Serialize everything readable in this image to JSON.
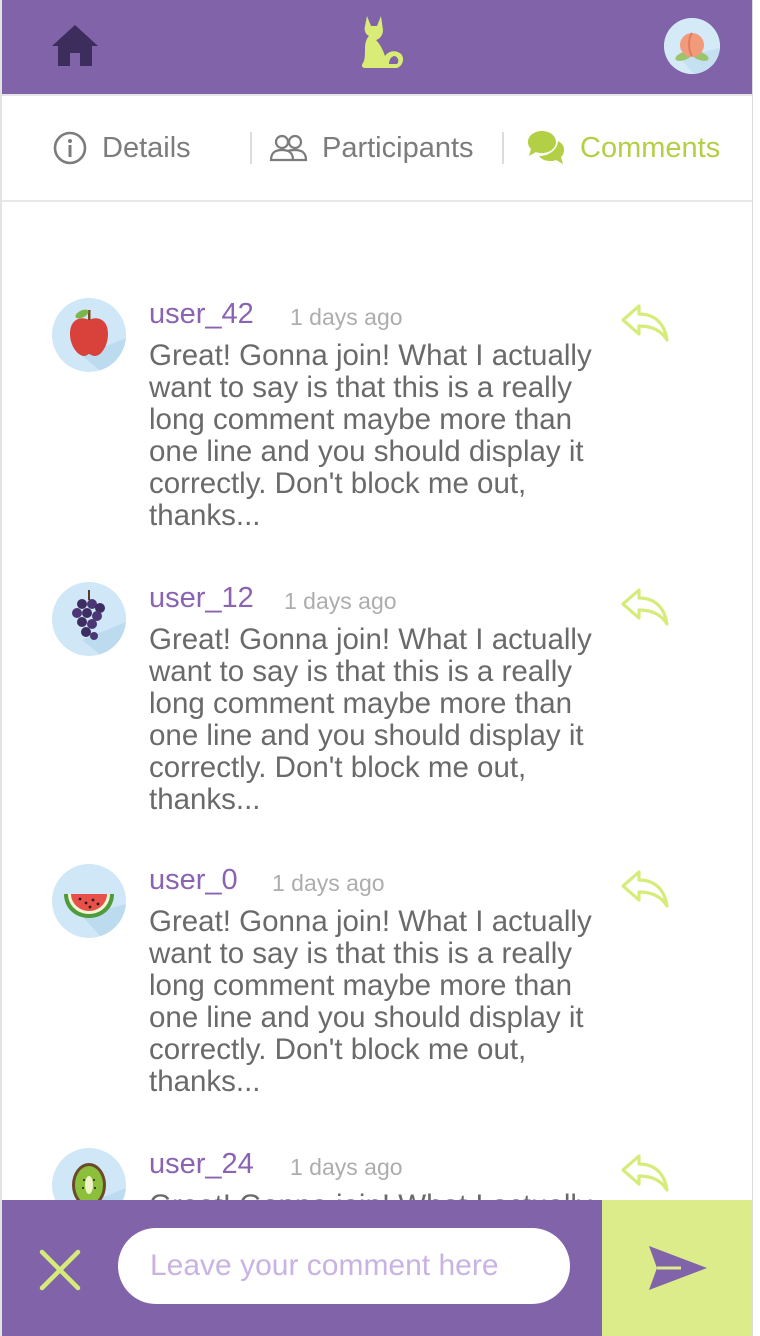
{
  "colors": {
    "brand_purple": "#8063a8",
    "accent_green": "#b2cf45",
    "reply_green": "#d6ec7a",
    "send_bg": "#dcec8a",
    "username": "#8a63b3",
    "text": "#6a6a6a",
    "muted": "#adadad"
  },
  "header": {
    "home_icon": "home-icon",
    "logo_icon": "cat-logo-icon",
    "avatar_icon": "peach-avatar-icon"
  },
  "tabs": [
    {
      "label": "Details",
      "icon": "info-icon",
      "active": false
    },
    {
      "label": "Participants",
      "icon": "people-icon",
      "active": false
    },
    {
      "label": "Comments",
      "icon": "chat-bubbles-icon",
      "active": true
    }
  ],
  "comments": [
    {
      "username": "user_42",
      "time": "1 days ago",
      "avatar": "apple-avatar-icon",
      "text": "Great! Gonna join! What I actually want to say is that this is a really long comment maybe more than one line and you should display it correctly. Don't block me out, thanks..."
    },
    {
      "username": "user_12",
      "time": "1 days ago",
      "avatar": "grapes-avatar-icon",
      "text": "Great! Gonna join! What I actually want to say is that this is a really long comment maybe more than one line and you should display it correctly. Don't block me out, thanks..."
    },
    {
      "username": "user_0",
      "time": "1 days ago",
      "avatar": "watermelon-avatar-icon",
      "text": "Great! Gonna join! What I actually want to say is that this is a really long comment maybe more than one line and you should display it correctly. Don't block me out, thanks..."
    },
    {
      "username": "user_24",
      "time": "1 days ago",
      "avatar": "kiwi-avatar-icon",
      "text": "Great! Gonna join! What I actually want to say is that this is a really long comment maybe more than one line and you should display it correctly. Don't block me out, thanks..."
    }
  ],
  "footer": {
    "input_placeholder": "Leave your comment here",
    "input_value": "",
    "close_icon": "close-icon",
    "send_icon": "send-icon"
  }
}
